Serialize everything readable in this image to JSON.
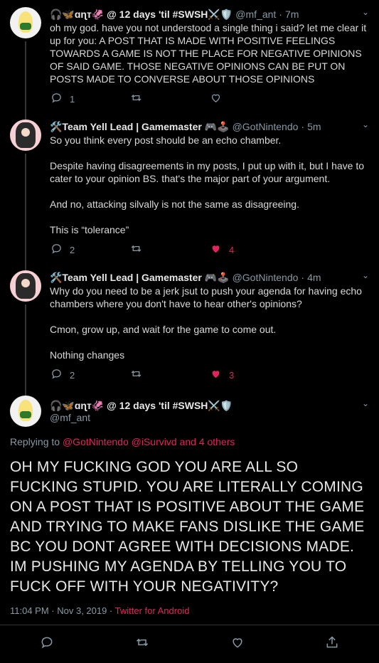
{
  "tweets": [
    {
      "name": "🎧🦋ɑɳт🦑 @ 12 days 'til #SWSH⚔️🛡️",
      "handle": "@mf_ant",
      "dot": "·",
      "time": "7m",
      "text": "oh my god. have you not understood a single thing i said? let me clear it up for you: A POST THAT IS MADE WITH POSITIVE FEELINGS TOWARDS A GAME IS NOT THE PLACE FOR NEGATIVE OPINIONS OF SAID GAME. THOSE NEGATIVE OPINIONS CAN BE PUT ON POSTS MADE TO CONVERSE ABOUT THOSE OPINIONS",
      "replies": "1",
      "retweets": "",
      "likes": ""
    },
    {
      "name": "🛠️Team Yell Lead | Gamemaster 🎮🕹️",
      "handle": "@GotNintendo",
      "dot": "·",
      "time": "5m",
      "text": "So you think every post should be an echo chamber.\n\nDespite having disagreements in my posts, I put up with it, but I have to cater to your opinion BS. that's the major part of your argument.\n\nAnd no, attacking silvally is not the same as disagreeing.\n\nThis is “tolerance”",
      "replies": "2",
      "retweets": "",
      "likes": "4"
    },
    {
      "name": "🛠️Team Yell Lead | Gamemaster 🎮🕹️",
      "handle": "@GotNintendo",
      "dot": "·",
      "time": "4m",
      "text": "Why do you need to be a jerk jsut to push your agenda for having echo chambers where you don't have to hear other's opinions?\n\nCmon, grow up, and wait for the game to come out.\n\nNothing changes",
      "replies": "2",
      "retweets": "",
      "likes": "3"
    }
  ],
  "main": {
    "name": "🎧🦋ɑɳт🦑 @ 12 days 'til #SWSH⚔️🛡️",
    "handle": "@mf_ant",
    "replying_prefix": "Replying to ",
    "replying_to": "@GotNintendo @iSurvivd and 4 others",
    "text": "OH MY FUCKING GOD YOU ARE ALL SO FUCKING STUPID. YOU ARE LITERALLY COMING ON A POST THAT IS POSITIVE ABOUT THE GAME AND TRYING TO MAKE FANS DISLIKE THE GAME BC YOU DONT AGREE WITH DECISIONS MADE. IM PUSHING MY AGENDA BY TELLING YOU TO FUCK OFF WITH YOUR NEGATIVITY?",
    "timestamp": "11:04 PM · Nov 3, 2019 · ",
    "source": "Twitter for Android"
  },
  "icons": {
    "reply": "reply-icon",
    "retweet": "retweet-icon",
    "like": "heart-icon",
    "share": "share-icon",
    "chevron": "chevron-down-icon"
  },
  "colors": {
    "background": "#000000",
    "accent": "#e0245e",
    "muted": "#8899a6"
  }
}
